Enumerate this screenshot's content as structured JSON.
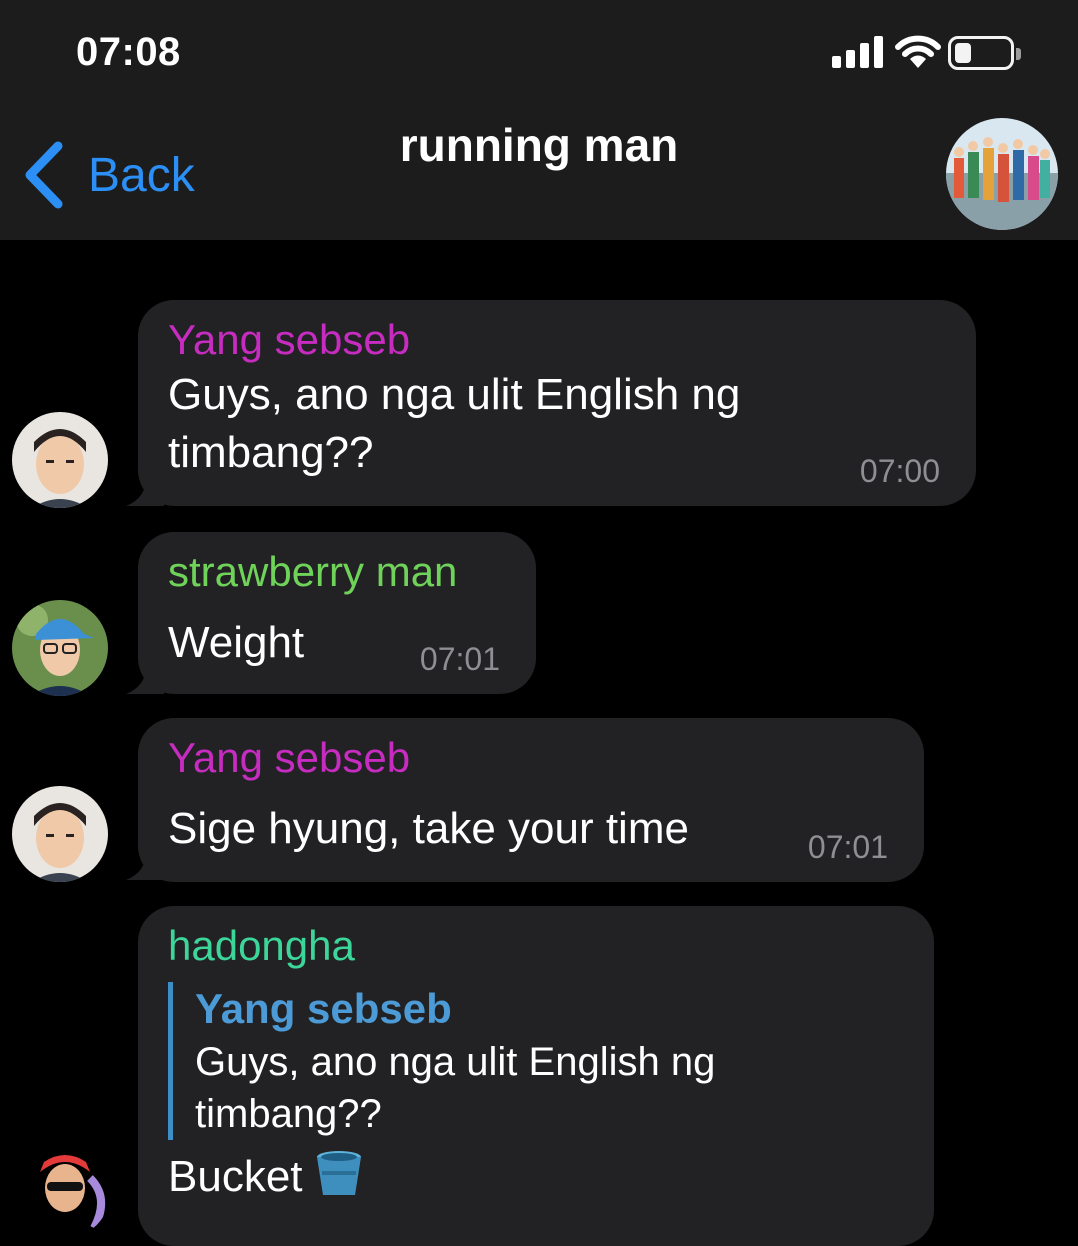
{
  "status_bar": {
    "time": "07:08"
  },
  "header": {
    "back_label": "Back",
    "title": "running man"
  },
  "colors": {
    "accent": "#2b8ff5",
    "yang_sebseb": "#c62cc0",
    "strawberry_man": "#6fd35a",
    "hadongha": "#3dd69a",
    "reply_bar": "#3d8ec6"
  },
  "messages": [
    {
      "sender": "Yang sebseb",
      "lines": [
        "Guys, ano nga ulit English ng",
        "timbang??"
      ],
      "time": "07:00"
    },
    {
      "sender": "strawberry man",
      "lines": [
        "Weight"
      ],
      "time": "07:01"
    },
    {
      "sender": "Yang sebseb",
      "lines": [
        "Sige hyung, take your time"
      ],
      "time": "07:01"
    },
    {
      "sender": "hadongha",
      "reply": {
        "sender": "Yang sebseb",
        "lines": [
          "Guys, ano nga ulit English ng",
          "timbang??"
        ]
      },
      "lines": [
        "Bucket"
      ]
    }
  ]
}
